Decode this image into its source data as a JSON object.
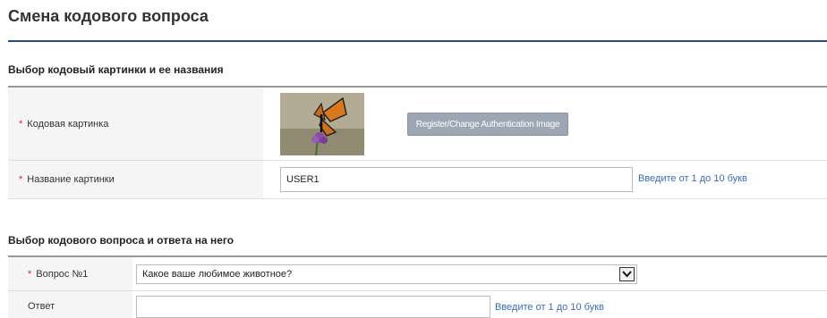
{
  "page": {
    "title": "Смена кодового вопроса"
  },
  "image_section": {
    "title": "Выбор кодовый картинки и ее названия",
    "image_row": {
      "required_mark": "*",
      "label": "Кодовая картинка",
      "button_label": "Register/Change Authentication Image"
    },
    "name_row": {
      "required_mark": "*",
      "label": "Название картинки",
      "value": "USER1",
      "hint": "Введите от 1 до 10 букв"
    }
  },
  "question_section": {
    "title": "Выбор кодового вопроса и ответа на него",
    "question_row": {
      "required_mark": "*",
      "label": "Вопрос №1",
      "selected": "Какое ваше любимое животное?"
    },
    "answer_row": {
      "label": "Ответ",
      "value": "",
      "hint": "Введите от 1 до 10 букв"
    }
  },
  "colors": {
    "accent_rule": "#2e4a7a",
    "required": "#d22222",
    "hint": "#3a6cb0",
    "button": "#9da6b3"
  },
  "icons": {
    "image_thumb": "butterfly-image",
    "dropdown": "chevron-down-icon"
  }
}
